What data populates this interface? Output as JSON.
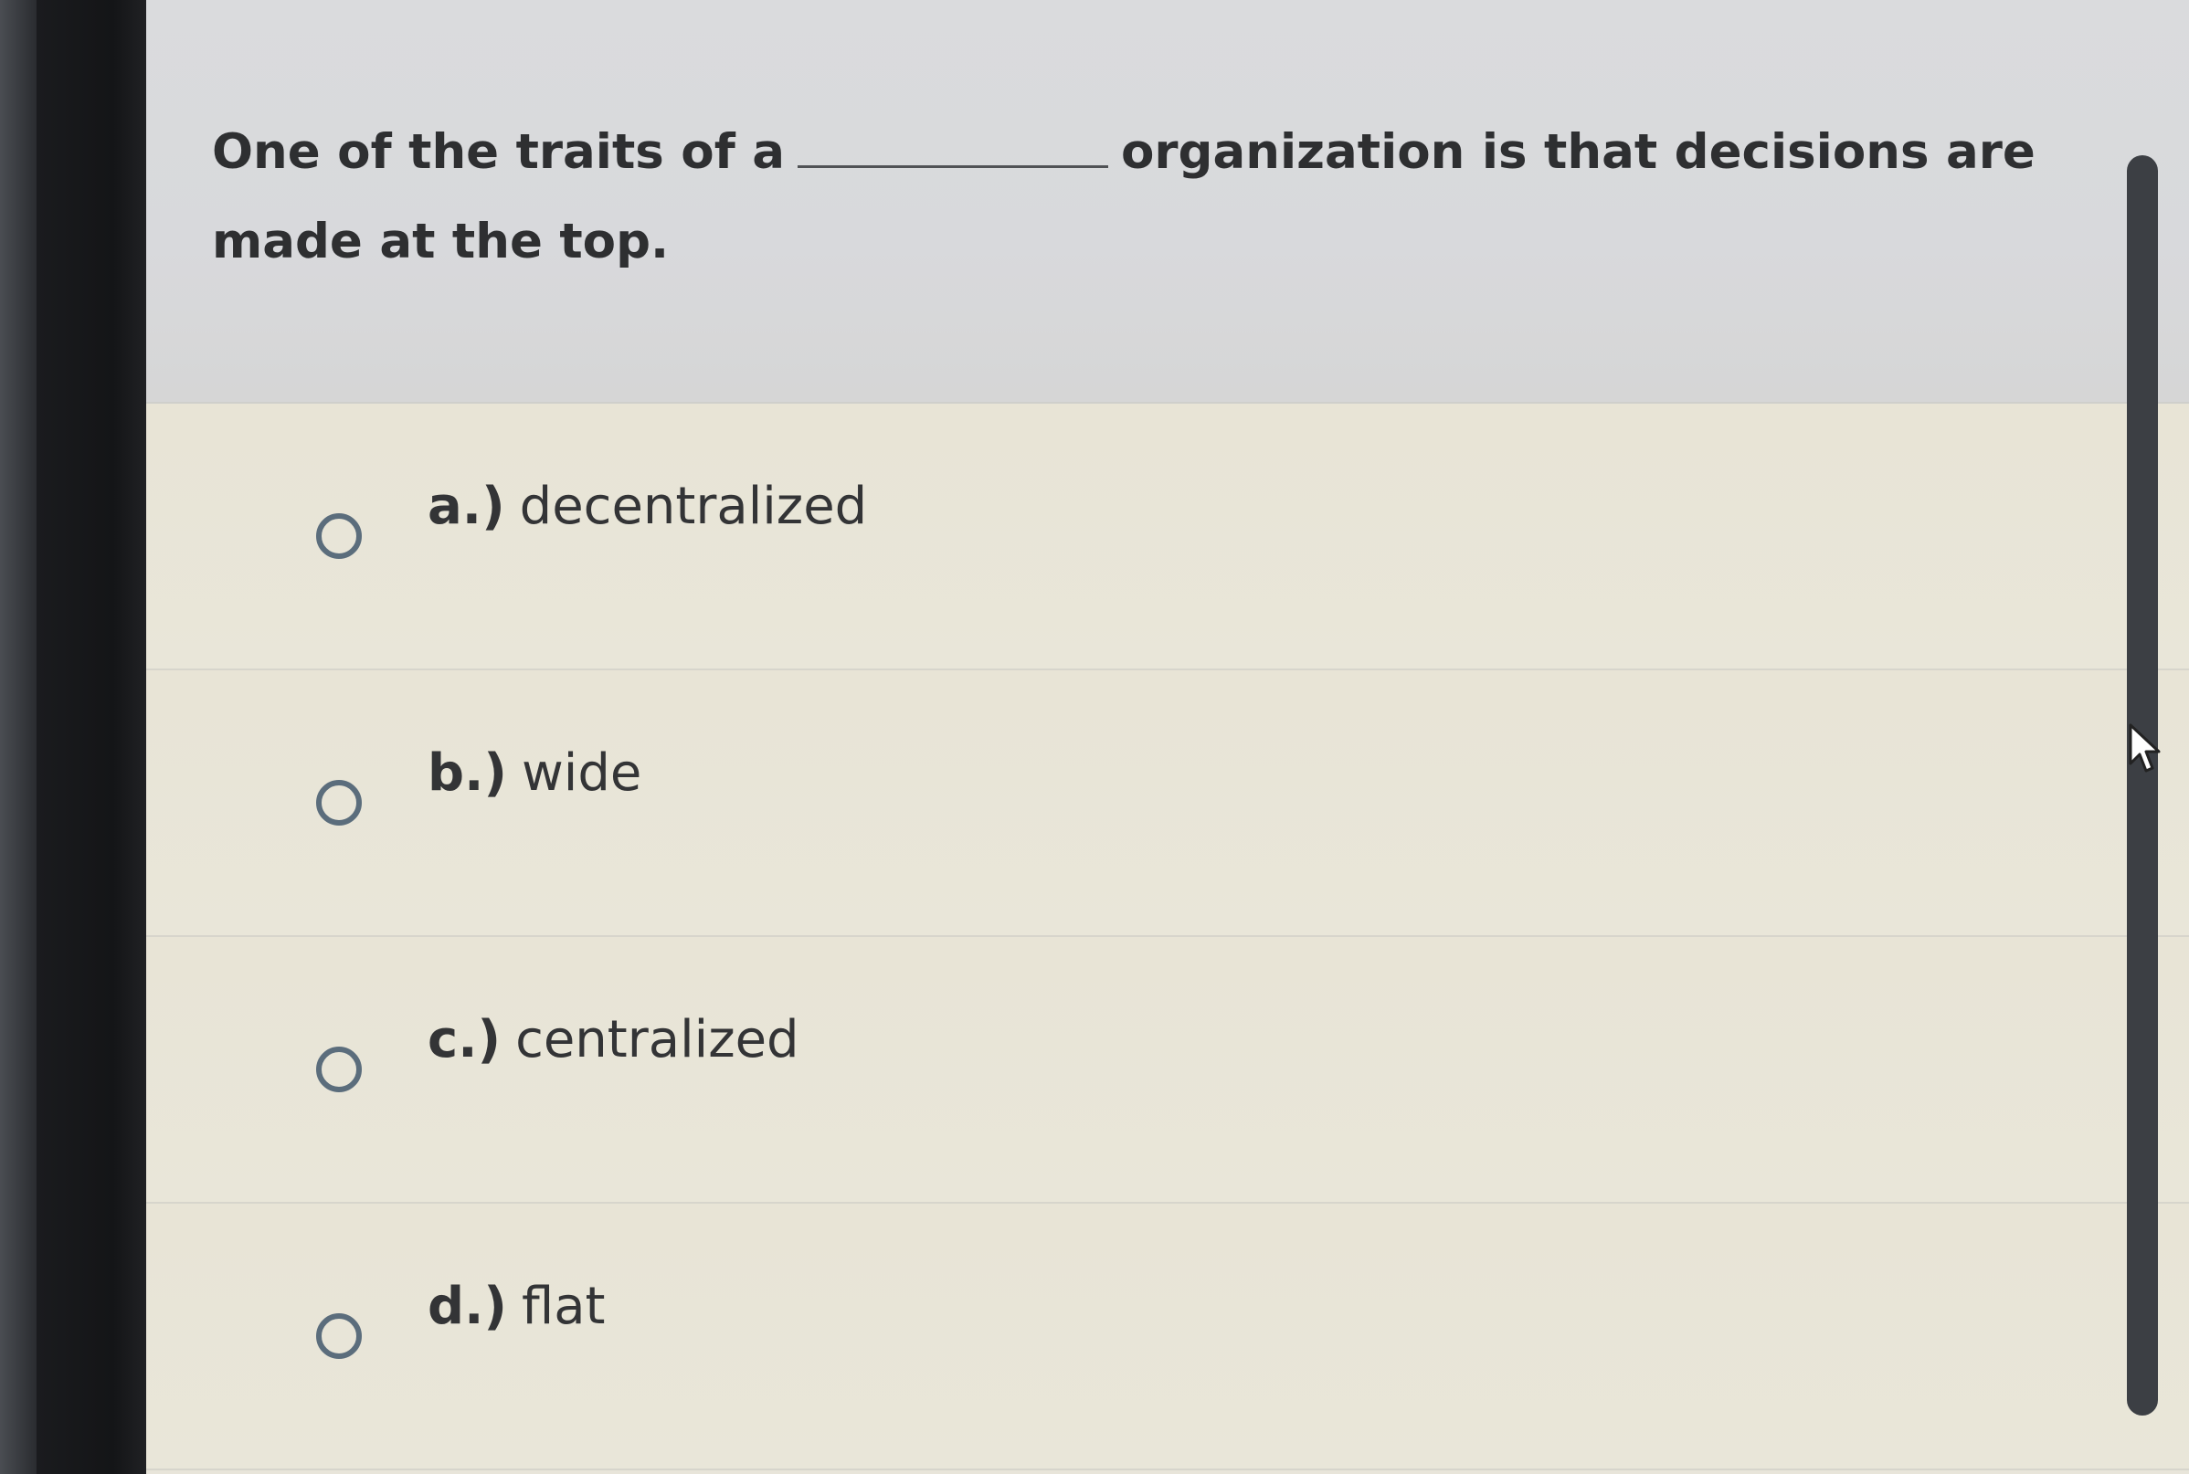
{
  "question": {
    "prefix": "One of the traits of a",
    "suffix": "organization is that decisions are made at the top."
  },
  "options": [
    {
      "letter": "a.)",
      "text": "decentralized",
      "selected": false
    },
    {
      "letter": "b.)",
      "text": "wide",
      "selected": false
    },
    {
      "letter": "c.)",
      "text": "centralized",
      "selected": false
    },
    {
      "letter": "d.)",
      "text": "flat",
      "selected": false
    }
  ],
  "colors": {
    "radio_border": "#5b6d7c",
    "question_background": "#d8d9dc",
    "options_background": "#e8e5da",
    "text": "#2e2f31"
  },
  "icons": {
    "radio": "radio-button-icon",
    "cursor": "mouse-pointer-icon"
  }
}
